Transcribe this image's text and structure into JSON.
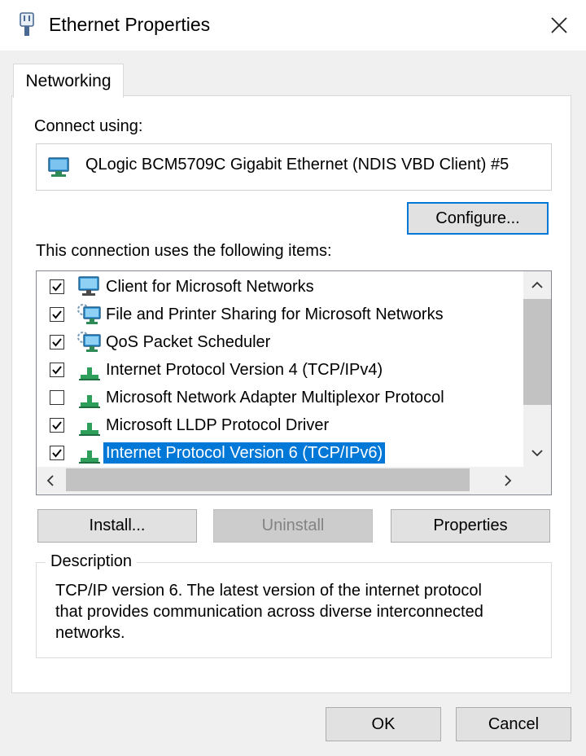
{
  "window": {
    "title": "Ethernet Properties",
    "close_symbol": "✕"
  },
  "tabs": [
    {
      "label": "Networking"
    }
  ],
  "connect_using": {
    "label": "Connect using:",
    "adapter_name": "QLogic BCM5709C Gigabit Ethernet (NDIS VBD Client) #5"
  },
  "configure_button": "Configure...",
  "items_label": "This connection uses the following items:",
  "items": [
    {
      "label": "Client for Microsoft Networks",
      "checked": true,
      "icon": "network-client-icon",
      "selected": false
    },
    {
      "label": "File and Printer Sharing for Microsoft Networks",
      "checked": true,
      "icon": "network-service-icon",
      "selected": false
    },
    {
      "label": "QoS Packet Scheduler",
      "checked": true,
      "icon": "network-service-icon",
      "selected": false
    },
    {
      "label": "Internet Protocol Version 4 (TCP/IPv4)",
      "checked": true,
      "icon": "network-protocol-icon",
      "selected": false
    },
    {
      "label": "Microsoft Network Adapter Multiplexor Protocol",
      "checked": false,
      "icon": "network-protocol-icon",
      "selected": false
    },
    {
      "label": "Microsoft LLDP Protocol Driver",
      "checked": true,
      "icon": "network-protocol-icon",
      "selected": false
    },
    {
      "label": "Internet Protocol Version 6 (TCP/IPv6)",
      "checked": true,
      "icon": "network-protocol-icon",
      "selected": true
    }
  ],
  "action_buttons": {
    "install": "Install...",
    "uninstall": "Uninstall",
    "properties": "Properties"
  },
  "description": {
    "title": "Description",
    "lines": [
      "TCP/IP version 6. The latest version of the internet protocol",
      "that provides communication across diverse interconnected",
      "networks."
    ]
  },
  "footer_buttons": {
    "ok": "OK",
    "cancel": "Cancel"
  },
  "colors": {
    "selection": "#0078d7",
    "dialog_bg": "#f0f0f0",
    "button_bg": "#e1e1e1"
  }
}
